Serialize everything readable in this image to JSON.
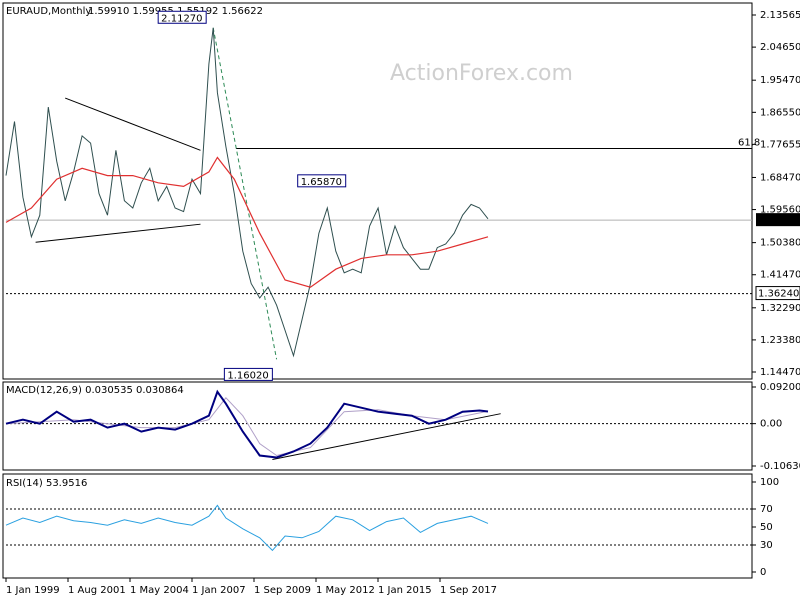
{
  "header": {
    "symbol": "EURAUD,Monthly",
    "ohlc": "1.59910 1.59955 1.55192 1.56622"
  },
  "watermark": "ActionForex.com",
  "colors": {
    "price": "#2f4f4f",
    "ma": "#e03030",
    "macd": "#000080",
    "signal": "#b0a0c8",
    "rsi": "#2aa0e0",
    "level": "#000000",
    "trend_dash": "#2e8b57"
  },
  "chart_data": [
    {
      "type": "line",
      "title": "EURAUD,Monthly",
      "x_ticks": [
        "1 Jan 1999",
        "1 Aug 2001",
        "1 May 2004",
        "1 Jan 2007",
        "1 Sep 2009",
        "1 May 2012",
        "1 Jan 2015",
        "1 Sep 2017"
      ],
      "y_ticks": [
        "2.13565",
        "2.04650",
        "1.95470",
        "1.86550",
        "1.77655",
        "1.68470",
        "1.59560",
        "1.50380",
        "1.41470",
        "1.32290",
        "1.23380",
        "1.14470"
      ],
      "ylim": [
        1.1447,
        2.13565
      ],
      "series": [
        {
          "name": "price",
          "x": [
            0,
            4,
            8,
            12,
            16,
            20,
            24,
            28,
            32,
            36,
            40,
            44,
            48,
            52,
            56,
            60,
            64,
            68,
            72,
            76,
            80,
            84,
            88,
            92,
            96,
            98,
            100,
            104,
            108,
            112,
            116,
            120,
            124,
            128,
            132,
            136,
            140,
            144,
            148,
            152,
            156,
            160,
            164,
            168,
            172,
            176,
            180,
            184,
            188,
            192,
            196,
            200,
            204,
            208,
            212,
            216,
            220,
            224,
            228
          ],
          "values": [
            1.69,
            1.84,
            1.63,
            1.52,
            1.58,
            1.88,
            1.73,
            1.62,
            1.7,
            1.8,
            1.78,
            1.64,
            1.58,
            1.76,
            1.62,
            1.6,
            1.67,
            1.71,
            1.62,
            1.66,
            1.6,
            1.59,
            1.68,
            1.64,
            2.0,
            2.1,
            1.92,
            1.77,
            1.64,
            1.48,
            1.39,
            1.35,
            1.38,
            1.33,
            1.26,
            1.19,
            1.29,
            1.39,
            1.53,
            1.6,
            1.48,
            1.42,
            1.43,
            1.42,
            1.55,
            1.6,
            1.47,
            1.55,
            1.49,
            1.46,
            1.43,
            1.43,
            1.49,
            1.5,
            1.53,
            1.58,
            1.61,
            1.6,
            1.57
          ]
        },
        {
          "name": "moving average",
          "x": [
            0,
            12,
            24,
            36,
            48,
            60,
            72,
            84,
            96,
            100,
            108,
            120,
            132,
            144,
            156,
            168,
            180,
            192,
            204,
            216,
            228
          ],
          "values": [
            1.56,
            1.6,
            1.68,
            1.71,
            1.69,
            1.69,
            1.67,
            1.66,
            1.7,
            1.74,
            1.68,
            1.53,
            1.4,
            1.38,
            1.43,
            1.46,
            1.47,
            1.47,
            1.48,
            1.5,
            1.52
          ]
        }
      ],
      "annotations": [
        {
          "label": "2.11270",
          "x": 98,
          "y": 2.1127
        },
        {
          "label": "1.65870",
          "x": 164,
          "y": 1.6587
        },
        {
          "label": "1.16020",
          "x": 126,
          "y": 1.1602
        },
        {
          "label": "61.8",
          "y": 1.765
        },
        {
          "label": "1.56622",
          "y": 1.56622
        },
        {
          "label": "1.36240",
          "y": 1.3624
        }
      ],
      "x_range": [
        0,
        228
      ]
    },
    {
      "type": "line",
      "title": "MACD(12,26,9) 0.030535 0.030864",
      "y_ticks": [
        "0.092004",
        "0.00",
        "-0.106308"
      ],
      "ylim": [
        -0.106308,
        0.092004
      ],
      "series": [
        {
          "name": "MACD",
          "x": [
            0,
            8,
            16,
            24,
            32,
            40,
            48,
            56,
            64,
            72,
            80,
            88,
            96,
            100,
            104,
            112,
            120,
            128,
            136,
            144,
            152,
            160,
            168,
            176,
            184,
            192,
            200,
            208,
            216,
            224,
            228
          ],
          "values": [
            0.0,
            0.01,
            0.0,
            0.03,
            0.005,
            0.01,
            -0.01,
            0.0,
            -0.02,
            -0.01,
            -0.015,
            0.0,
            0.02,
            0.08,
            0.05,
            -0.02,
            -0.08,
            -0.085,
            -0.07,
            -0.05,
            -0.01,
            0.05,
            0.04,
            0.03,
            0.025,
            0.02,
            0.0,
            0.01,
            0.03,
            0.033,
            0.0305
          ]
        },
        {
          "name": "signal",
          "x": [
            0,
            16,
            32,
            48,
            64,
            80,
            96,
            104,
            112,
            120,
            128,
            144,
            160,
            176,
            192,
            208,
            228
          ],
          "values": [
            0.0,
            0.005,
            0.01,
            0.0,
            -0.01,
            -0.01,
            0.01,
            0.065,
            0.02,
            -0.05,
            -0.08,
            -0.06,
            0.03,
            0.035,
            0.02,
            0.01,
            0.0309
          ]
        }
      ]
    },
    {
      "type": "line",
      "title": "RSI(14) 53.9516",
      "y_ticks": [
        "100",
        "70",
        "50",
        "30",
        "0"
      ],
      "ylim": [
        0,
        100
      ],
      "series": [
        {
          "name": "RSI",
          "x": [
            0,
            8,
            16,
            24,
            32,
            40,
            48,
            56,
            64,
            72,
            80,
            88,
            96,
            100,
            104,
            112,
            120,
            126,
            132,
            140,
            148,
            156,
            164,
            172,
            180,
            188,
            196,
            204,
            212,
            220,
            228
          ],
          "values": [
            52,
            60,
            55,
            62,
            57,
            55,
            52,
            58,
            54,
            60,
            55,
            52,
            62,
            74,
            60,
            48,
            38,
            24,
            40,
            38,
            45,
            62,
            58,
            46,
            56,
            60,
            44,
            54,
            58,
            62,
            53.95
          ]
        }
      ]
    }
  ]
}
